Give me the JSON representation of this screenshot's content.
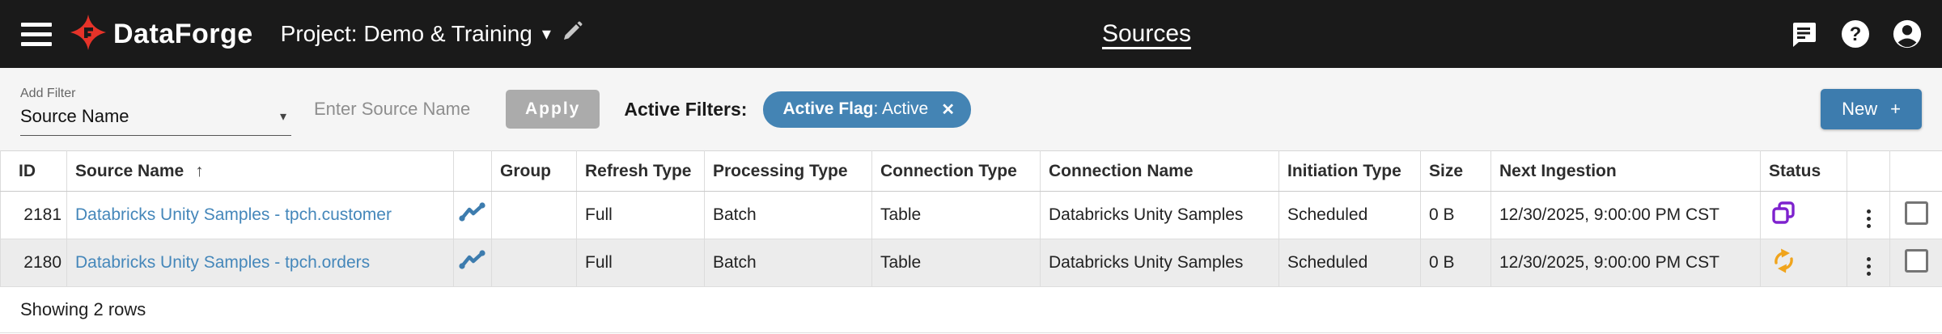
{
  "topbar": {
    "brand": "DataForge",
    "project_label": "Project: Demo & Training",
    "page_title": "Sources"
  },
  "icons": {
    "caret_down": "▾",
    "sort_asc": "↑",
    "close": "✕",
    "plus": "+"
  },
  "filterbar": {
    "add_filter_label": "Add Filter",
    "filter_select_value": "Source Name",
    "search_placeholder": "Enter Source Name",
    "apply_label": "Apply",
    "active_filters_label": "Active Filters:",
    "chip": {
      "name": "Active Flag",
      "value": ": Active"
    },
    "new_button_label": "New"
  },
  "table": {
    "headers": [
      "ID",
      "Source Name",
      "",
      "Group",
      "Refresh Type",
      "Processing Type",
      "Connection Type",
      "Connection Name",
      "Initiation Type",
      "Size",
      "Next Ingestion",
      "Status",
      "",
      ""
    ],
    "sort": {
      "column": "Source Name",
      "direction": "ascending"
    },
    "rows": [
      {
        "id": "2181",
        "source_name": "Databricks Unity Samples - tpch.customer",
        "group": "",
        "refresh_type": "Full",
        "processing_type": "Batch",
        "connection_type": "Table",
        "connection_name": "Databricks Unity Samples",
        "initiation_type": "Scheduled",
        "size": "0 B",
        "next_ingestion": "12/30/2025, 9:00:00 PM CST",
        "status_icon": "layers-purple"
      },
      {
        "id": "2180",
        "source_name": "Databricks Unity Samples - tpch.orders",
        "group": "",
        "refresh_type": "Full",
        "processing_type": "Batch",
        "connection_type": "Table",
        "connection_name": "Databricks Unity Samples",
        "initiation_type": "Scheduled",
        "size": "0 B",
        "next_ingestion": "12/30/2025, 9:00:00 PM CST",
        "status_icon": "sync-amber"
      }
    ],
    "footer": "Showing 2 rows"
  },
  "colors": {
    "topbar_bg": "#1a1a1a",
    "accent_blue": "#3d7cae",
    "chip_blue": "#4484b4",
    "link_blue": "#4587ba",
    "logo_red": "#e63329",
    "status_purple": "#7e22ce",
    "status_amber": "#f0a41c",
    "row_alt": "#ececec",
    "apply_disabled": "#ababab"
  }
}
